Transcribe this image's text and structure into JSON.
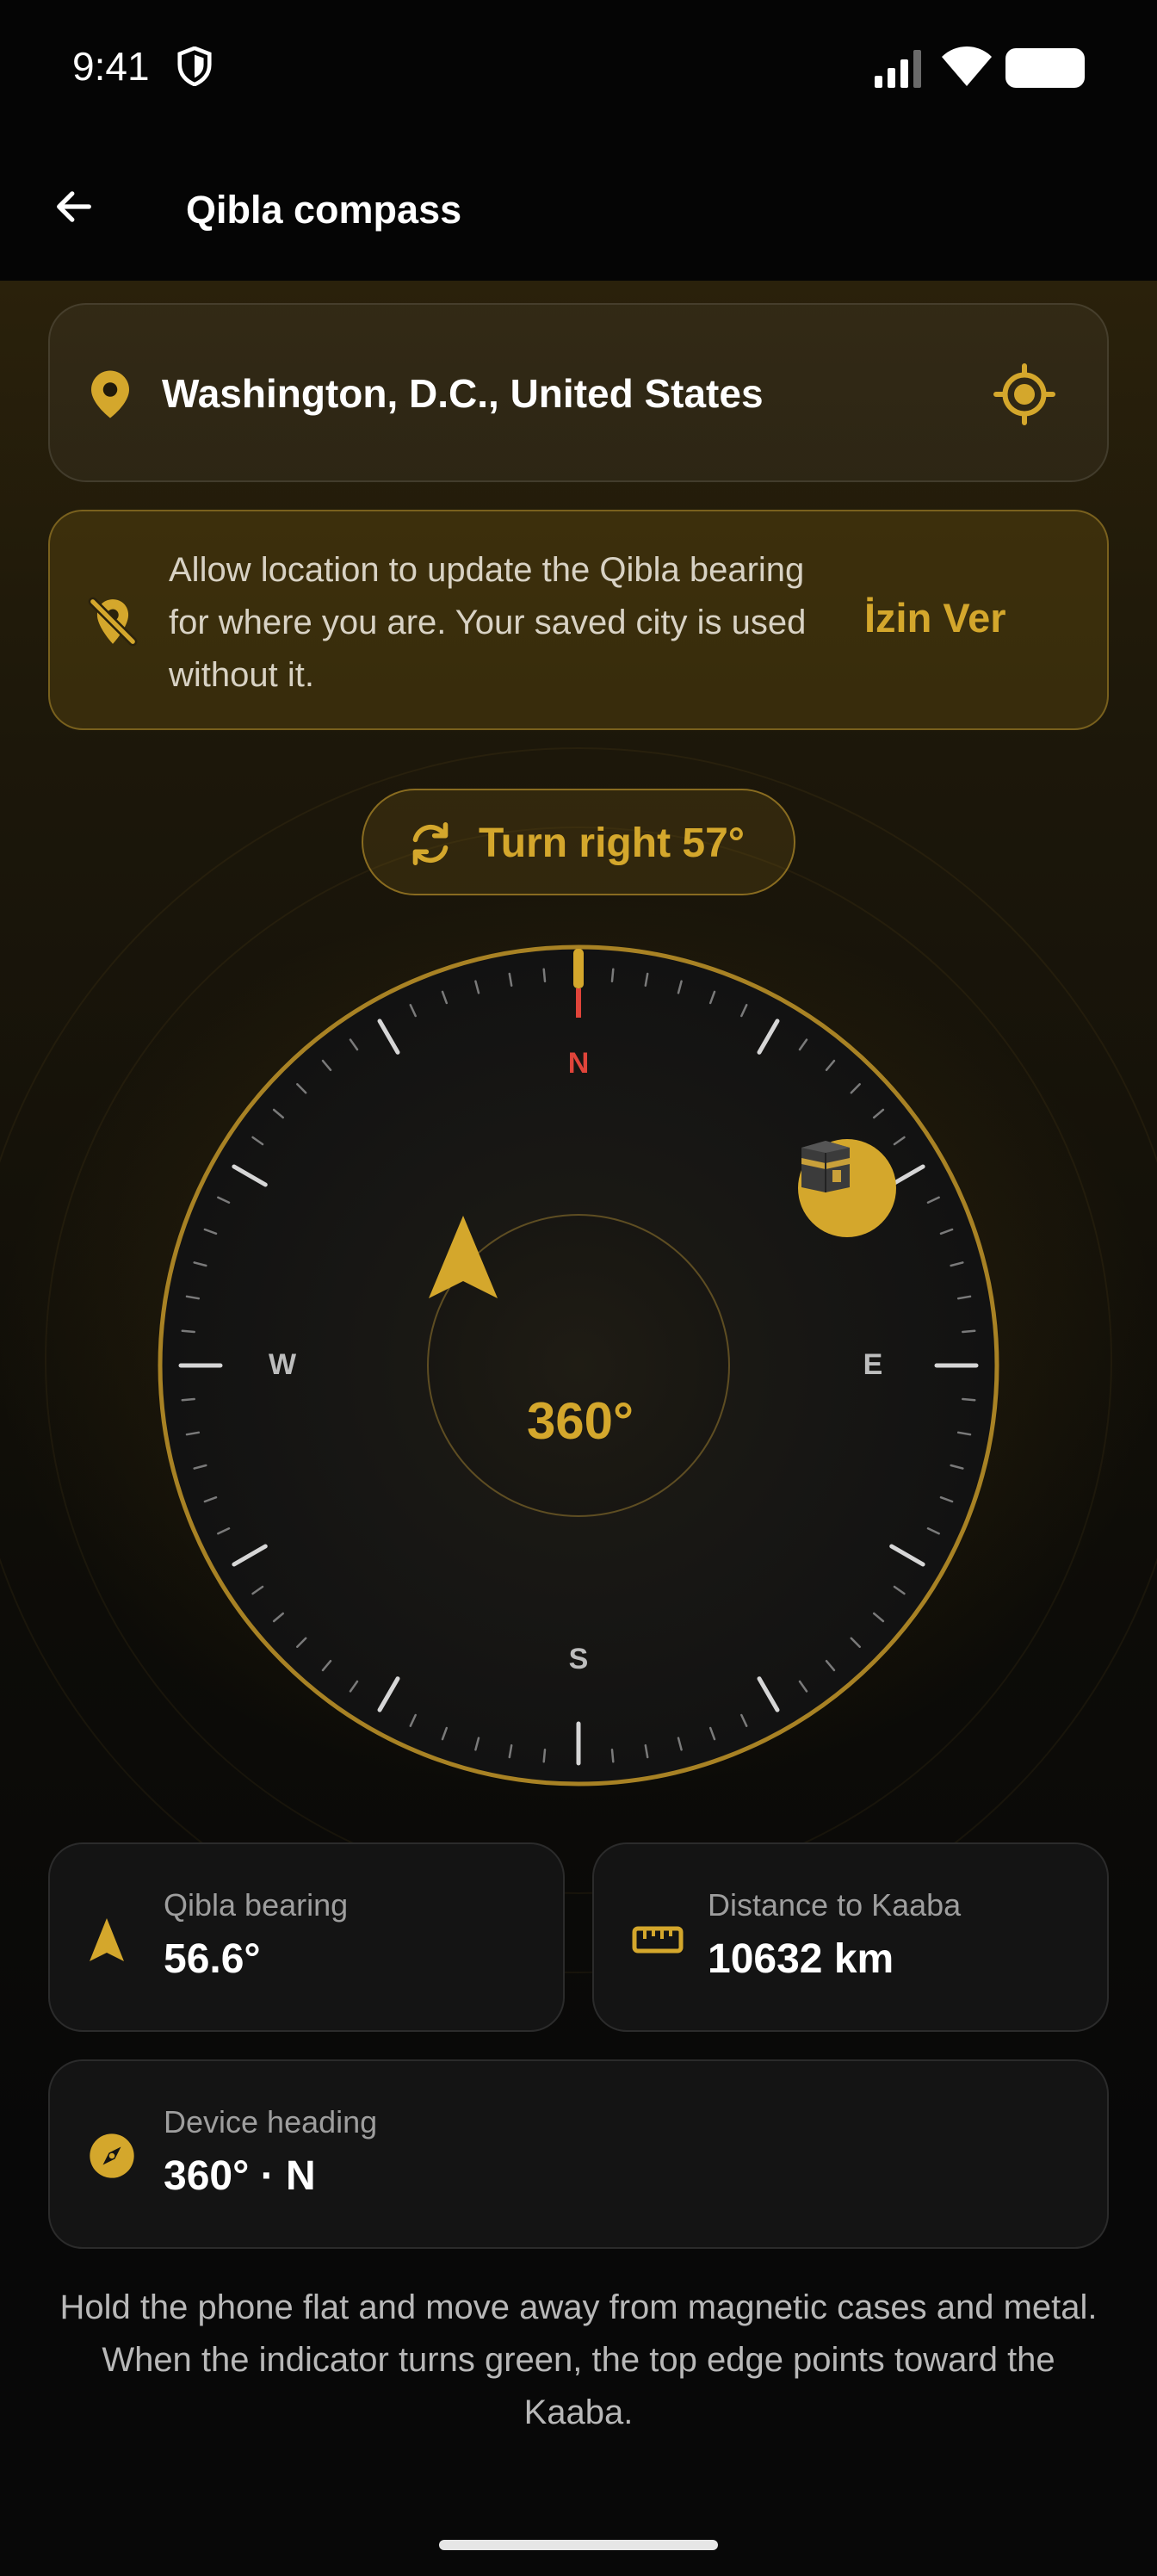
{
  "status_bar": {
    "time": "9:41"
  },
  "app_bar": {
    "title": "Qibla compass"
  },
  "location": {
    "city": "Washington, D.C., United States"
  },
  "permission_banner": {
    "text": "Allow location to update the Qibla bearing for where you are. Your saved city is used without it.",
    "button_label": "İzin Ver"
  },
  "turn_hint": {
    "text": "Turn right 57°"
  },
  "compass": {
    "north": "N",
    "east": "E",
    "south": "S",
    "west": "W",
    "heading_display": "360°",
    "qibla_bearing_deg": 56.6,
    "device_heading_deg": 360
  },
  "cards": {
    "qibla_bearing": {
      "label": "Qibla bearing",
      "value": "56.6°"
    },
    "distance": {
      "label": "Distance to Kaaba",
      "value": "10632 km"
    },
    "heading": {
      "label": "Device heading",
      "value": "360° · N"
    }
  },
  "hint": "Hold the phone flat and move away from magnetic cases and metal. When the indicator turns green, the top edge points toward the Kaaba.",
  "colors": {
    "accent": "#d4a72c",
    "north": "#e0443a",
    "background": "#080808"
  }
}
